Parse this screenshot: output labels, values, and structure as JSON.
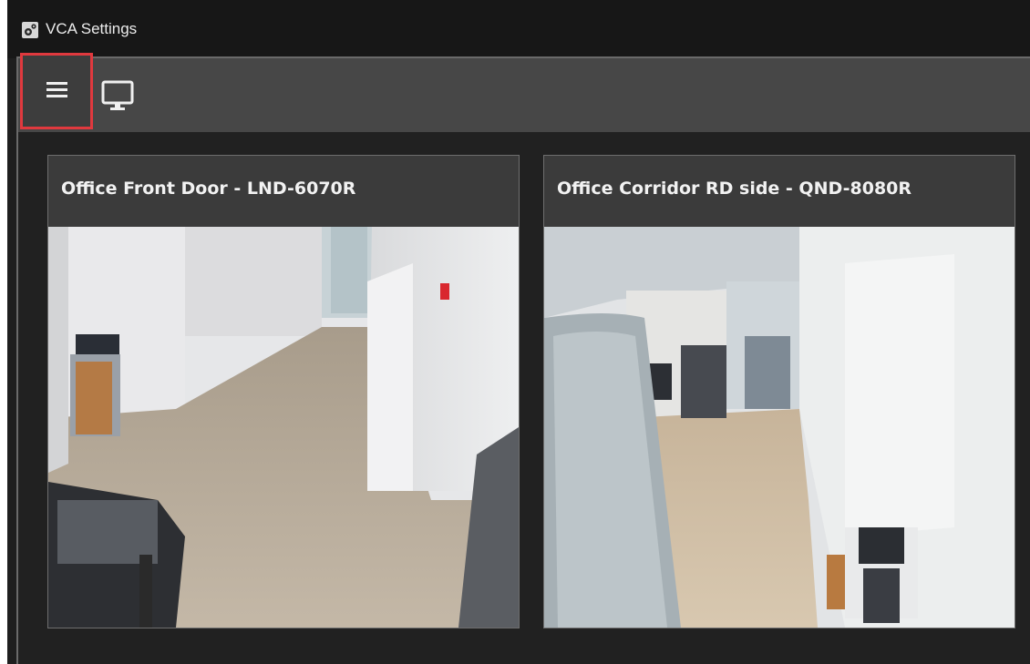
{
  "window": {
    "title": "VCA Settings",
    "title_icon": "settings-gears-icon"
  },
  "toolbar": {
    "menu_icon": "hamburger-menu-icon",
    "monitor_icon": "monitor-icon",
    "highlight_color": "#e0393e"
  },
  "cameras": [
    {
      "title": "Office Front Door - LND-6070R"
    },
    {
      "title": "Office Corridor RD side - QND-8080R"
    }
  ]
}
